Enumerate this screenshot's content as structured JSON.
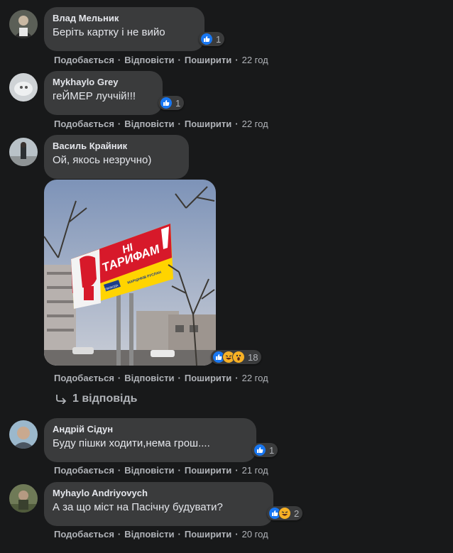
{
  "comments": [
    {
      "author": "Влад Мельник",
      "text": "Беріть картку і не вийо",
      "reactions": "1",
      "like": "Подобається",
      "reply": "Відповісти",
      "share": "Поширити",
      "time": "22 год"
    },
    {
      "author": "Mykhaylo Grey",
      "text": "геЙМЕР луччій!!!",
      "reactions": "1",
      "like": "Подобається",
      "reply": "Відповісти",
      "share": "Поширити",
      "time": "22 год"
    },
    {
      "author": "Василь Крайник",
      "text": "Ой, якось незручно)",
      "reactions": "18",
      "like": "Подобається",
      "reply": "Відповісти",
      "share": "Поширити",
      "time": "22 год",
      "replies": "1 відповідь",
      "billboard": {
        "line1": "НІ",
        "line2": "ТАРИФАМ",
        "name": "МАРЦІНКІВ РУСЛАН",
        "party": "СВОБОДА"
      }
    },
    {
      "author": "Андрій Сідун",
      "text": "Буду пішки ходити,нема грош....",
      "reactions": "1",
      "like": "Подобається",
      "reply": "Відповісти",
      "share": "Поширити",
      "time": "21 год"
    },
    {
      "author": "Myhaylo Andriyovych",
      "text": "А за що міст на Пасічну будувати?",
      "reactions": "2",
      "like": "Подобається",
      "reply": "Відповісти",
      "share": "Поширити",
      "time": "20 год"
    }
  ],
  "colors": {
    "background": "#18191a",
    "bubble": "#3a3b3c",
    "like": "#1877f2",
    "haha": "#f7b125",
    "billboard_red": "#d7192a",
    "billboard_yellow": "#ffd400"
  }
}
